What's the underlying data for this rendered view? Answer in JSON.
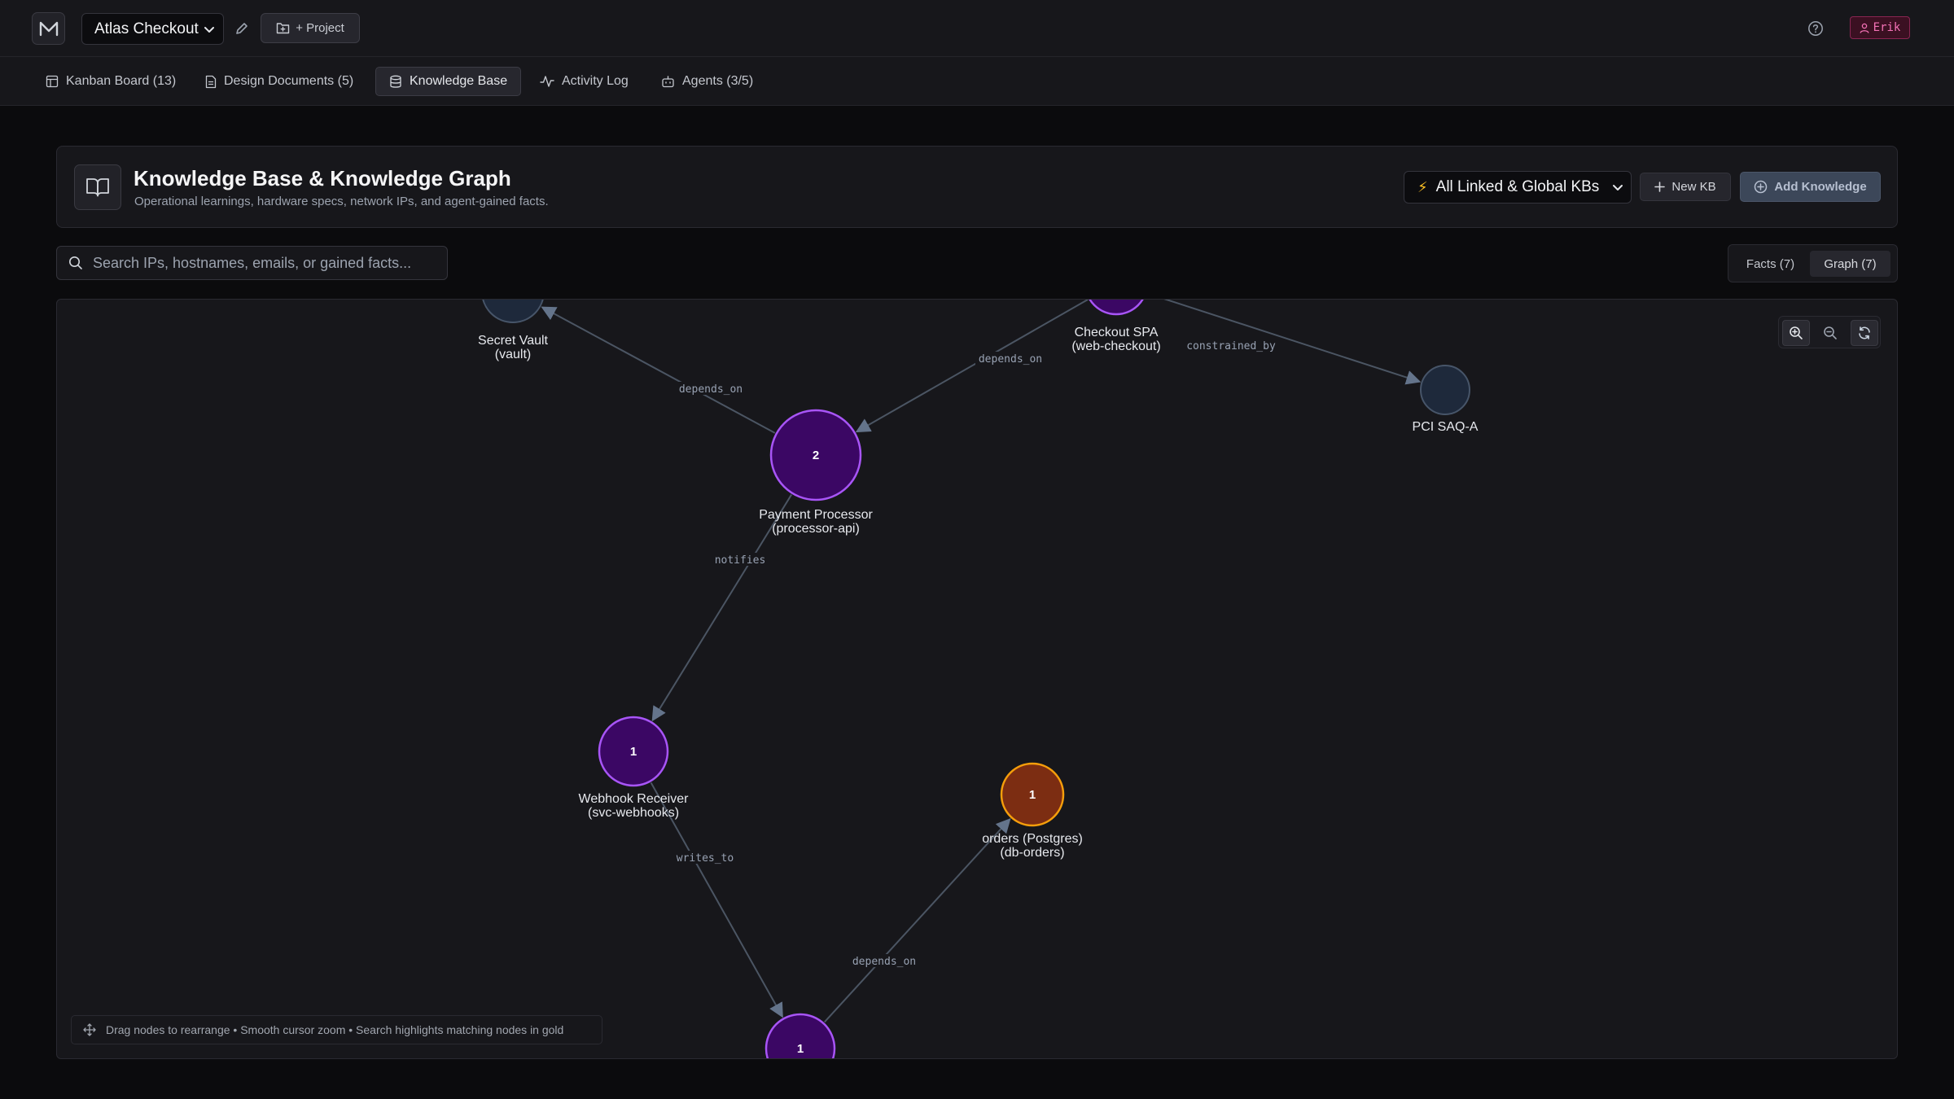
{
  "header": {
    "project_name": "Atlas Checkout",
    "add_project_label": "+ Project",
    "user_name": "Erik"
  },
  "tabs": [
    {
      "label": "Kanban Board (13)",
      "icon": "kanban-icon"
    },
    {
      "label": "Design Documents (5)",
      "icon": "document-icon"
    },
    {
      "label": "Knowledge Base",
      "icon": "database-icon",
      "active": true
    },
    {
      "label": "Activity Log",
      "icon": "activity-icon"
    },
    {
      "label": "Agents (3/5)",
      "icon": "bot-icon"
    }
  ],
  "kb": {
    "title": "Knowledge Base & Knowledge Graph",
    "subtitle": "Operational learnings, hardware specs, network IPs, and agent-gained facts.",
    "scope_select": "All Linked & Global KBs",
    "new_kb_label": "New KB",
    "add_knowledge_label": "Add Knowledge"
  },
  "search": {
    "placeholder": "Search IPs, hostnames, emails, or gained facts...",
    "value": ""
  },
  "view_toggle": {
    "facts_label": "Facts (7)",
    "graph_label": "Graph (7)",
    "active": "graph"
  },
  "graph": {
    "nodes": [
      {
        "id": "vault",
        "label": [
          "Secret Vault",
          "(vault)"
        ],
        "count": "",
        "kind": "neutral"
      },
      {
        "id": "web-checkout",
        "label": [
          "Checkout SPA",
          "(web-checkout)"
        ],
        "count": "",
        "kind": "service"
      },
      {
        "id": "pci",
        "label": [
          "PCI SAQ-A"
        ],
        "count": "",
        "kind": "neutral"
      },
      {
        "id": "processor",
        "label": [
          "Payment Processor",
          "(processor-api)"
        ],
        "count": "2",
        "kind": "service"
      },
      {
        "id": "webhooks",
        "label": [
          "Webhook Receiver",
          "(svc-webhooks)"
        ],
        "count": "1",
        "kind": "service"
      },
      {
        "id": "db-orders",
        "label": [
          "orders (Postgres)",
          "(db-orders)"
        ],
        "count": "1",
        "kind": "database"
      },
      {
        "id": "bottom",
        "label": [],
        "count": "1",
        "kind": "service"
      }
    ],
    "edges": [
      {
        "from": "processor",
        "to": "vault",
        "label": "depends_on"
      },
      {
        "from": "web-checkout",
        "to": "processor",
        "label": "depends_on"
      },
      {
        "from": "web-checkout",
        "to": "pci",
        "label": "constrained_by"
      },
      {
        "from": "processor",
        "to": "webhooks",
        "label": "notifies"
      },
      {
        "from": "webhooks",
        "to": "bottom",
        "label": "writes_to"
      },
      {
        "from": "bottom",
        "to": "db-orders",
        "label": "depends_on"
      }
    ],
    "hint": "Drag nodes to rearrange • Smooth cursor zoom • Search highlights matching nodes in gold"
  },
  "colors": {
    "background": "#0b0b0d",
    "panel": "#17171b",
    "service_fill": "#3b0764",
    "service_stroke": "#a855f7",
    "database_fill": "#7c2d12",
    "database_stroke": "#f59e0b",
    "neutral_fill": "#1e293b",
    "neutral_stroke": "#475569",
    "edge": "#4b5563",
    "user_badge": "#f472b6"
  }
}
